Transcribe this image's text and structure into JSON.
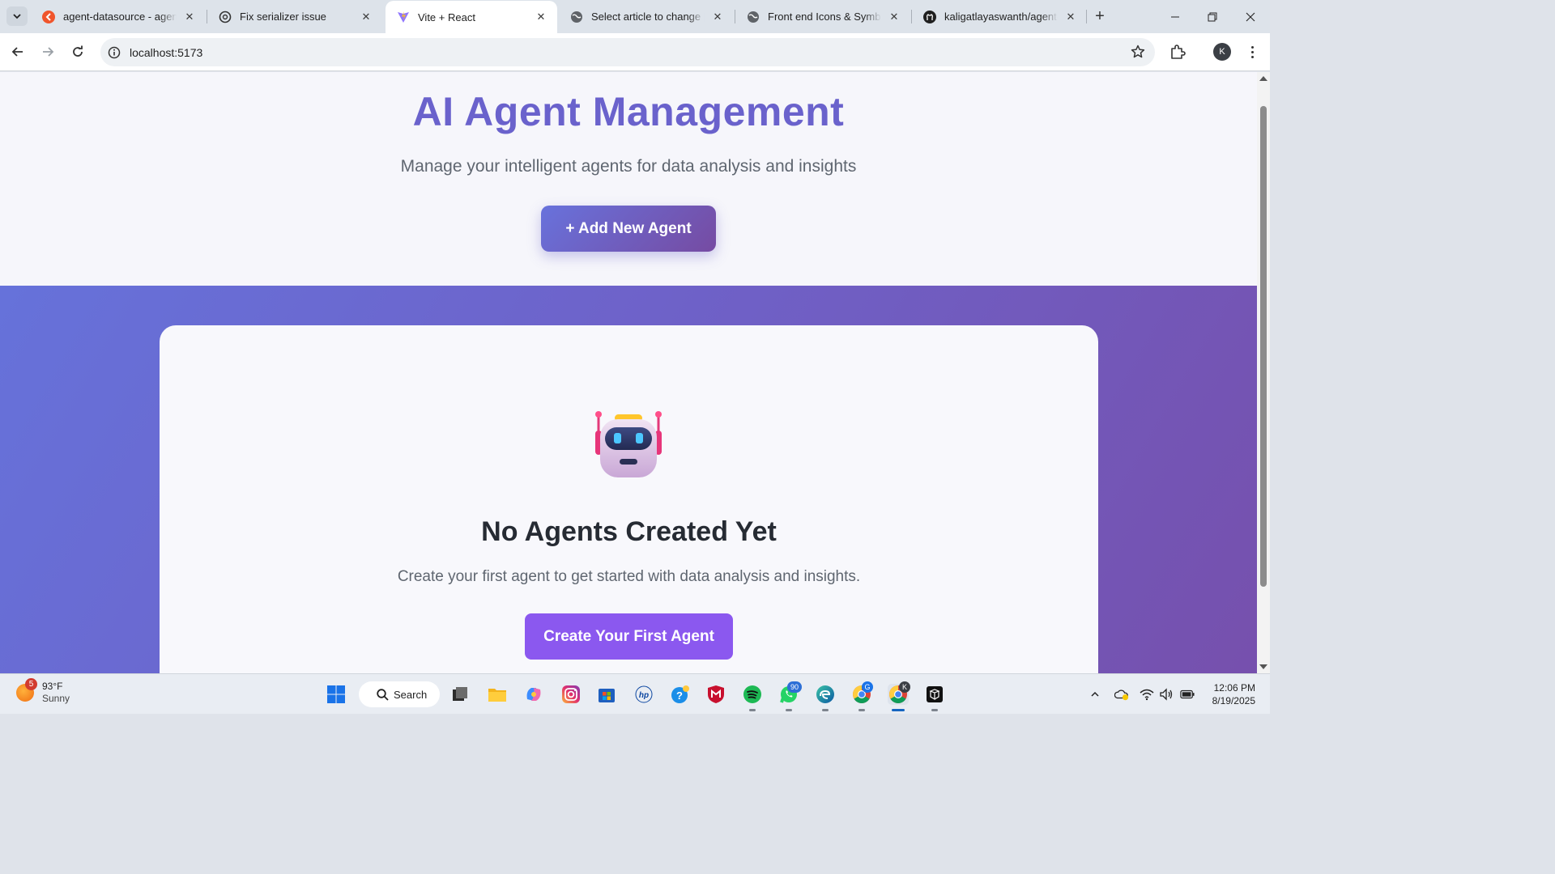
{
  "browser": {
    "tabs": [
      {
        "title": "agent-datasource - agenta",
        "icon": "agenta-icon",
        "active": false
      },
      {
        "title": "Fix serializer issue",
        "icon": "openai-icon",
        "active": false
      },
      {
        "title": "Vite + React",
        "icon": "vite-icon",
        "active": true
      },
      {
        "title": "Select article to change | D",
        "icon": "globe-icon",
        "active": false
      },
      {
        "title": "Front end Icons & Symbols",
        "icon": "globe-icon",
        "active": false
      },
      {
        "title": "kaligatlayaswanth/agent-s",
        "icon": "github-icon",
        "active": false
      }
    ],
    "url": "localhost:5173",
    "profile_initial": "K"
  },
  "page": {
    "title": "AI Agent Management",
    "subtitle": "Manage your intelligent agents for data analysis and insights",
    "add_button": "+ Add New Agent",
    "empty_state": {
      "icon": "robot-icon",
      "heading": "No Agents Created Yet",
      "message": "Create your first agent to get started with data analysis and insights.",
      "button": "Create Your First Agent"
    },
    "colors": {
      "title": "#6a62cc",
      "gradient_start": "#667eea",
      "gradient_end": "#764ba2",
      "primary_button": "#8b58ef"
    }
  },
  "taskbar": {
    "weather": {
      "temp": "93°F",
      "condition": "Sunny",
      "badge": "5"
    },
    "search_label": "Search",
    "whatsapp_badge": "90",
    "chrome_profile_badge": "G",
    "active_chrome_badge": "K",
    "clock": {
      "time": "12:06 PM",
      "date": "8/19/2025"
    }
  }
}
